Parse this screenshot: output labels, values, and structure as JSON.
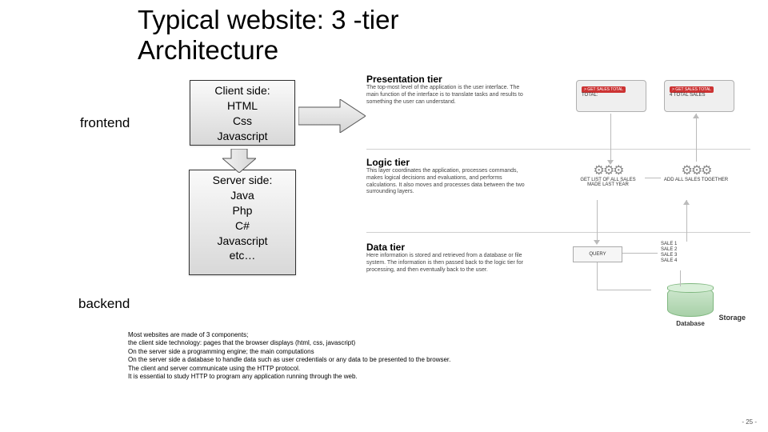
{
  "title_line1": "Typical website: 3 -tier",
  "title_line2": "Architecture",
  "labels": {
    "frontend": "frontend",
    "backend": "backend"
  },
  "client_box": {
    "header": "Client side:",
    "items": [
      "HTML",
      "Css",
      "Javascript"
    ]
  },
  "server_box": {
    "header": "Server side:",
    "items": [
      "Java",
      "Php",
      "C#",
      "Javascript",
      "etc…"
    ]
  },
  "diagram": {
    "presentation": {
      "title": "Presentation tier",
      "desc": "The top-most level of the application is the user interface. The main function of the interface is to translate tasks and results to something the user can understand.",
      "box1": {
        "btn": "> GET SALES TOTAL",
        "caption": "TOTAL:"
      },
      "box2": {
        "btn": "> GET SALES TOTAL",
        "caption": "4 TOTAL SALES"
      }
    },
    "logic": {
      "title": "Logic tier",
      "desc": "This layer coordinates the application, processes commands, makes logical decisions and evaluations, and performs calculations. It also moves and processes data between the two surrounding layers.",
      "gear1": "GET LIST OF ALL SALES MADE LAST YEAR",
      "gear2": "ADD ALL SALES TOGETHER"
    },
    "data": {
      "title": "Data tier",
      "desc": "Here information is stored and retrieved from a database or file system. The information is then passed back to the logic tier for processing, and then eventually back to the user.",
      "query": "QUERY",
      "sales": [
        "SALE 1",
        "SALE 2",
        "SALE 3",
        "SALE 4"
      ]
    },
    "storage": {
      "label": "Storage",
      "db_label": "Database"
    }
  },
  "notes": [
    "Most websites are made of 3 components;",
    " the client side technology: pages that the browser displays (html, css, javascript)",
    " On the server side a programming engine; the main computations",
    " On the server side a database to handle data such as user credentials or any data to be presented to the browser.",
    " The client and server communicate using the HTTP protocol.",
    " It is essential to study HTTP to program any application running through the web."
  ],
  "page_number": "- 25 -"
}
